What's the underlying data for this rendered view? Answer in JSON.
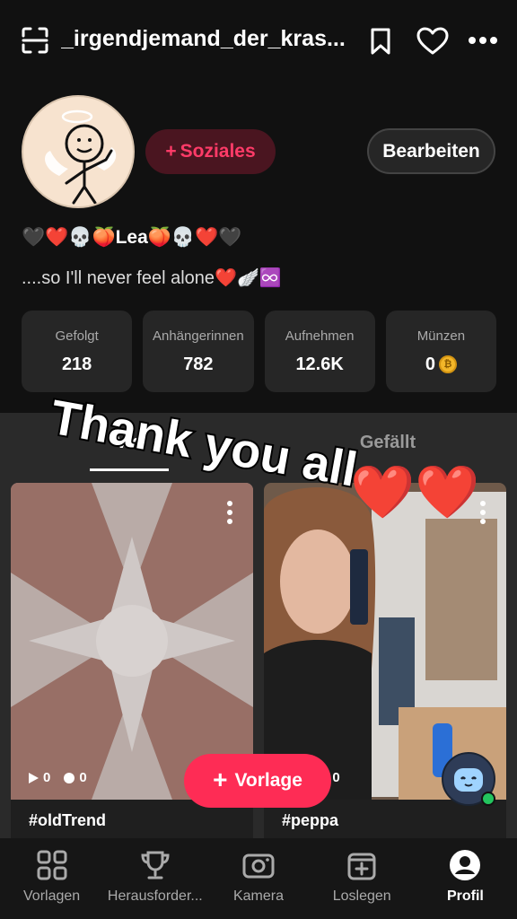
{
  "header": {
    "username": "_irgendjemand_der_kras...",
    "icons": [
      "scan-icon",
      "bookmark-icon",
      "heart-icon",
      "more-icon"
    ]
  },
  "profile": {
    "social_label": "Soziales",
    "edit_label": "Bearbeiten",
    "bio_name": "🖤❤️💀🍑Lea🍑💀❤️🖤",
    "bio_line": "....so I'll never feel alone❤️🪽♾️"
  },
  "stats": [
    {
      "label": "Gefolgt",
      "value": "218"
    },
    {
      "label": "Anhängerinnen",
      "value": "782"
    },
    {
      "label": "Aufnehmen",
      "value": "12.6K"
    },
    {
      "label": "Münzen",
      "value": "0"
    }
  ],
  "tabs": {
    "videos": "Vid",
    "liked": "Gefällt"
  },
  "overlay": {
    "text": "Thank you all",
    "hearts": "❤️❤️"
  },
  "cards": [
    {
      "views": "0",
      "likes": "0",
      "tag": "#oldTrend"
    },
    {
      "views": "0",
      "likes": "0",
      "tag": "#peppa"
    }
  ],
  "fab": {
    "label": "Vorlage"
  },
  "nav": [
    {
      "label": "Vorlagen",
      "icon": "grid-icon"
    },
    {
      "label": "Herausforder...",
      "icon": "trophy-icon"
    },
    {
      "label": "Kamera",
      "icon": "camera-icon"
    },
    {
      "label": "Loslegen",
      "icon": "add-square-icon"
    },
    {
      "label": "Profil",
      "icon": "profile-icon"
    }
  ],
  "colors": {
    "accent": "#fe2c55",
    "background": "#111111",
    "card": "#262626"
  }
}
